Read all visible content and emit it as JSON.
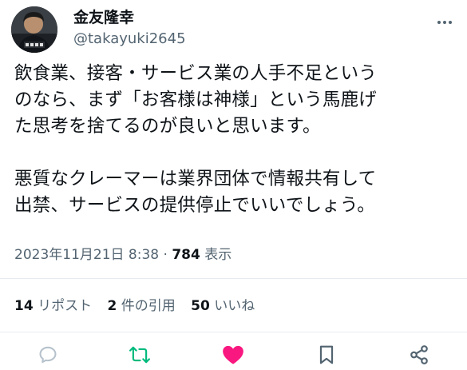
{
  "user": {
    "display_name": "金友隆幸",
    "handle": "@takayuki2645",
    "avatar_icon": "profile-photo"
  },
  "tweet": {
    "paragraphs": [
      "飲食業、接客・サービス業の人手不足という\nのなら、まず「お客様は神様」という馬鹿げ\nた思考を捨てるのが良いと思います。",
      "悪質なクレーマーは業界団体で情報共有して\n出禁、サービスの提供停止でいいでしょう。"
    ],
    "timestamp": "2023年11月21日 8:38",
    "separator": "·",
    "views_count": "784",
    "views_label": "表示"
  },
  "stats": {
    "reposts_count": "14",
    "reposts_label": "リポスト",
    "quotes_count": "2",
    "quotes_label": "件の引用",
    "likes_count": "50",
    "likes_label": "いいね"
  },
  "actions": {
    "reply_icon": "comment-icon",
    "retweet_icon": "retweet-icon",
    "like_icon": "heart-icon",
    "bookmark_icon": "bookmark-icon",
    "share_icon": "share-icon"
  },
  "colors": {
    "text_primary": "#0f1419",
    "text_secondary": "#536471",
    "retweet_active": "#00ba7c",
    "like_active": "#f91880",
    "divider": "#e6ecf0"
  }
}
